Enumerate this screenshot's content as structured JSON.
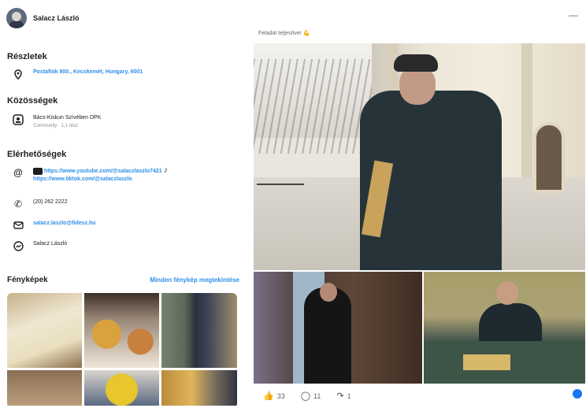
{
  "profile": {
    "name": "Salacz László"
  },
  "details": {
    "title": "Részletek",
    "address": "Postafiók 800., Kecskemét, Hungary, 6001"
  },
  "communities": {
    "title": "Közösségek",
    "item": "Bács-Kiskun Szívében DPK",
    "item_sub": "Community · 1,1 rész"
  },
  "contacts": {
    "title": "Elérhetőségek",
    "youtube": "https://www.youtube.com/@salaczlaszlo7421",
    "tiktok": "https://www.tiktok.com/@salaczlaszlo",
    "phone": "(20) 262 2222",
    "email": "salacz.laszlo@fidesz.hu",
    "messenger": "Salacz László"
  },
  "photos": {
    "title": "Fényképek",
    "see_all": "Minden fénykép megtekintése"
  },
  "post": {
    "caption": "Feladat teljesítve! 💪",
    "like_count": "33",
    "comment_count": "11",
    "share_count": "1"
  },
  "colors": {
    "link": "#2f8fe8",
    "accent": "#1877f2"
  }
}
